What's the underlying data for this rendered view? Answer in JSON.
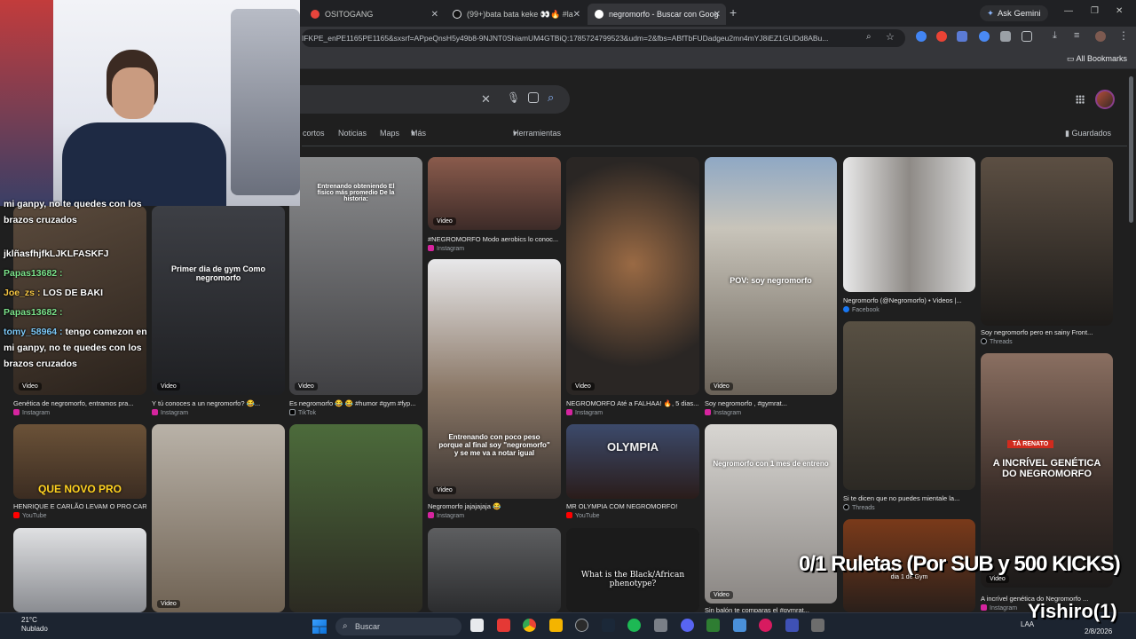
{
  "browser": {
    "tabs": [
      {
        "title": "OSITOGANG",
        "favicon_color": "#e8453c"
      },
      {
        "title": "(99+)bata bata keke 👀🔥 #la",
        "favicon_color": "#000000"
      },
      {
        "title": "negromorfo - Buscar con Goog",
        "favicon_color": "#ffffff"
      }
    ],
    "new_tab_label": "+",
    "ask_gemini": "Ask Gemini",
    "url": "IFKPE_enPE1165PE1165&sxsrf=APpeQnsH5y49b8-9NJNT0ShiamUM4GTBiQ:1785724799523&udm=2&fbs=ABfTbFUDadgeu2mn4mYJ8iEZ1GUDd8ABu...",
    "all_bookmarks": "All Bookmarks"
  },
  "google": {
    "filters": [
      "cortos",
      "Noticias",
      "Maps",
      "Más",
      "Herramientas"
    ],
    "saved": "Guardados"
  },
  "results": {
    "video_label": "Video",
    "col1": [
      {
        "caption": "Genética de negromorfo, entramos pra...",
        "source": "Instagram"
      },
      {
        "caption": "HENRIQUE E CARLÃO LEVAM O PRO CAR...",
        "source": "YouTube",
        "overlay": "QUE NOVO PRO"
      }
    ],
    "col2": [
      {
        "caption": "Y tú conoces a un negromorfo? 😂...",
        "source": "Instagram",
        "overlay": "Primer dia de gym Como negromorfo"
      }
    ],
    "col3": [
      {
        "caption": "Es negromorfo 😂 😂 #humor #gym #fyp...",
        "source": "TikTok",
        "overlay": "Entrenando obteniendo El físico más promedio De la historia:"
      }
    ],
    "col4": [
      {
        "caption": "#NEGROMORFO Modo aerobics lo conoc...",
        "source": "Instagram"
      },
      {
        "caption": "Negromorfo jajajajaja 😂",
        "source": "Instagram",
        "overlay": "Entrenando con poco peso porque al final soy \"negromorfo\" y se me va a notar igual"
      }
    ],
    "col5": [
      {
        "caption": "NEGROMORFO Até a FALHAA! 🔥, 5 dias...",
        "source": "Instagram"
      },
      {
        "caption": "MR OLYMPIA COM NEGROMORFO!",
        "source": "YouTube",
        "overlay": "OLYMPIA"
      },
      {
        "overlay": "What is the Black/African phenotype?"
      }
    ],
    "col6": [
      {
        "caption": "Soy negromorfo , #gymrat...",
        "source": "Instagram",
        "overlay": "POV: soy negromorfo"
      },
      {
        "caption": "Sin balón te comparas el #gymrat...",
        "overlay": "Negromorfo con 1 mes de entreno"
      }
    ],
    "col7": [
      {
        "caption": "Negromorfo (@Negromorfo) • Videos |...",
        "source": "Facebook"
      },
      {
        "caption": "Si te dicen que no puedes mientale la...",
        "source": "Threads"
      },
      {
        "overlay": "dia 1 de Gym"
      }
    ],
    "col8": [
      {
        "caption": "Soy negromorfo pero en sainy Front...",
        "source": "Threads"
      },
      {
        "caption": "A incrível genética do Negromorfo ...",
        "source": "Instagram",
        "overlay": "A INCRÍVEL GENÉTICA DO NEGROMORFO",
        "badge": "TÁ RENATO"
      }
    ]
  },
  "stream": {
    "chat": [
      {
        "user": "",
        "text": "mi ganpy, no te quedes con los"
      },
      {
        "user": "",
        "text": "brazos cruzados"
      },
      {
        "user": "",
        "text": "jklñasfhjfkLJKLFASKFJ"
      },
      {
        "user": "Papas13682 :",
        "text": ""
      },
      {
        "user": "Joe_zs :",
        "text": "LOS DE BAKI"
      },
      {
        "user": "Papas13682 :",
        "text": ""
      },
      {
        "user": "tomy_58964 :",
        "text": "tengo comezon en"
      },
      {
        "user": "",
        "text": "mi ganpy, no te quedes con los"
      },
      {
        "user": "",
        "text": "brazos cruzados"
      }
    ],
    "overlay_text": "0/1 Ruletas (Por SUB y 500 KICKS)",
    "username": "Yishiro(1)"
  },
  "taskbar": {
    "temperature": "21°C",
    "weather": "Nublado",
    "search_placeholder": "Buscar",
    "lang": "LAA",
    "date": "2/8/2026"
  }
}
